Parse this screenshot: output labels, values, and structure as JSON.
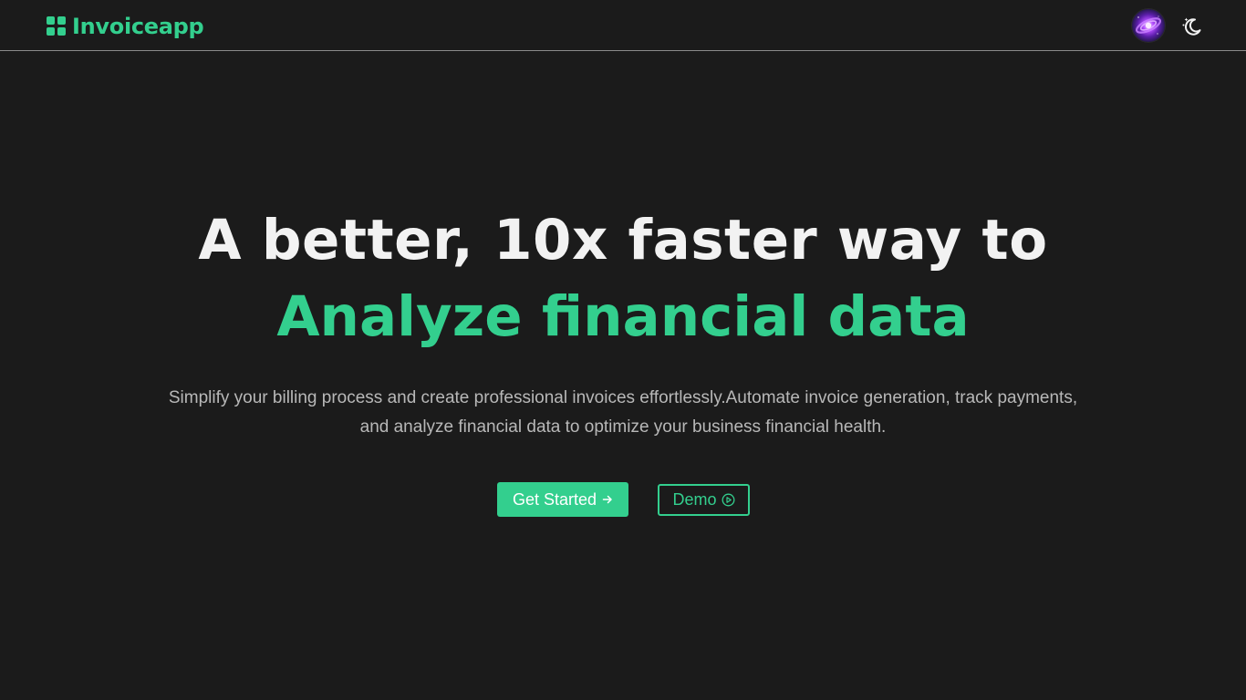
{
  "header": {
    "logo_text": "Invoiceapp",
    "logo_icon": "grid-icon",
    "avatar_icon": "galaxy-avatar",
    "theme_toggle_icon": "moon-stars-icon"
  },
  "hero": {
    "title_line1": "A better, 10x faster way to",
    "title_line2": "Analyze financial data",
    "description": "Simplify your billing process and create professional invoices effortlessly.Automate invoice generation, track payments, and analyze financial data to optimize your business financial health."
  },
  "actions": {
    "primary_label": "Get Started",
    "primary_icon": "arrow-right-icon",
    "secondary_label": "Demo",
    "secondary_icon": "play-circle-icon"
  },
  "colors": {
    "background": "#1b1b1b",
    "accent": "#33cf8e",
    "heading": "#f2f2f2",
    "body_text": "#b8b8b8"
  }
}
